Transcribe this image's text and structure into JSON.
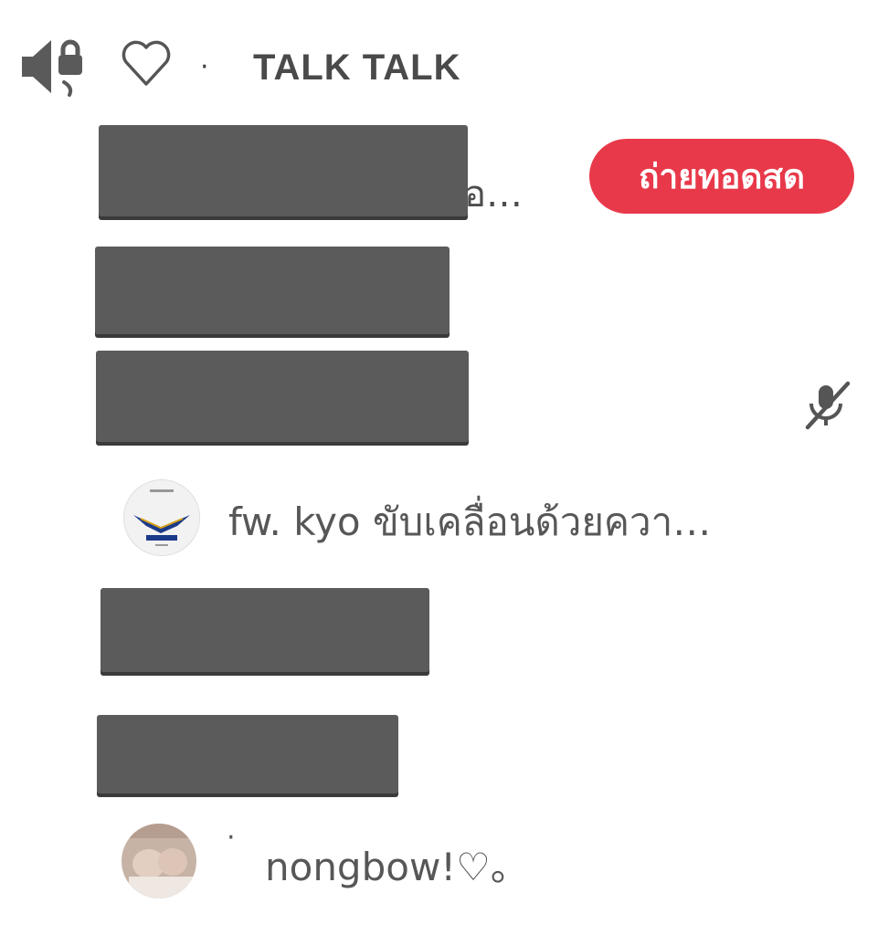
{
  "header": {
    "speaker_icon": "speaker-lock-icon",
    "heart_icon": "heart-outline-icon",
    "separator": "·",
    "channel_name": "TALK TALK"
  },
  "rows": {
    "row1": {
      "trailing_text": "อ…",
      "badge": "ถ่ายทอดสด",
      "badge_color": "#e8394a"
    },
    "row3": {
      "status_icon": "mic-muted-icon"
    },
    "row4": {
      "avatar_icon": "eagle-logo-avatar",
      "username": "fw. kyo ขับเคลื่อนด้วยควา…"
    },
    "row7": {
      "avatar_icon": "user-photo-avatar",
      "prefix": "·",
      "username": "nongbow!♡。"
    }
  }
}
